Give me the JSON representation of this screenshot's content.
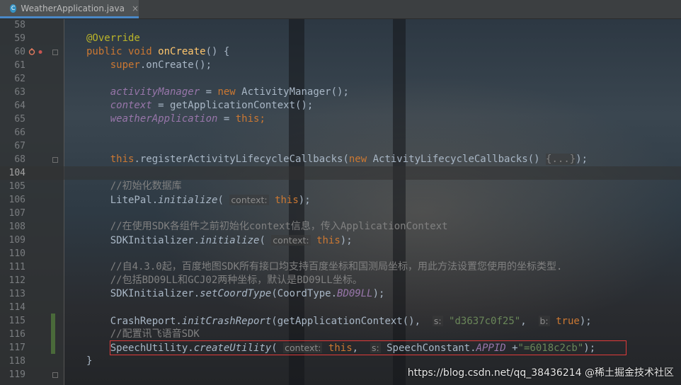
{
  "tab": {
    "filename": "WeatherApplication.java",
    "icon": "C",
    "close": "×"
  },
  "lines": [
    {
      "n": "58",
      "segs": []
    },
    {
      "n": "59",
      "segs": [
        {
          "t": "@Override",
          "c": "ann"
        }
      ]
    },
    {
      "n": "60",
      "segs": [
        {
          "t": "public void ",
          "c": "kw"
        },
        {
          "t": "onCreate",
          "c": "fn"
        },
        {
          "t": "() {",
          "c": ""
        }
      ]
    },
    {
      "n": "61",
      "segs": [
        {
          "t": "    super",
          "c": "kw"
        },
        {
          "t": ".onCreate();",
          "c": ""
        }
      ]
    },
    {
      "n": "62",
      "segs": []
    },
    {
      "n": "63",
      "segs": [
        {
          "t": "    ",
          "c": ""
        },
        {
          "t": "activityManager",
          "c": "field"
        },
        {
          "t": " = ",
          "c": ""
        },
        {
          "t": "new ",
          "c": "kw"
        },
        {
          "t": "ActivityManager();",
          "c": ""
        }
      ]
    },
    {
      "n": "64",
      "segs": [
        {
          "t": "    ",
          "c": ""
        },
        {
          "t": "context",
          "c": "field"
        },
        {
          "t": " = getApplicationContext();",
          "c": ""
        }
      ]
    },
    {
      "n": "65",
      "segs": [
        {
          "t": "    ",
          "c": ""
        },
        {
          "t": "weatherApplication",
          "c": "field"
        },
        {
          "t": " = ",
          "c": ""
        },
        {
          "t": "this",
          "c": "kw"
        },
        {
          "t": ";",
          "c": "kw"
        }
      ]
    },
    {
      "n": "66",
      "segs": []
    },
    {
      "n": "67",
      "segs": []
    },
    {
      "n": "68",
      "segs": [
        {
          "t": "    this",
          "c": "kw"
        },
        {
          "t": ".registerActivityLifecycleCallbacks(",
          "c": ""
        },
        {
          "t": "new ",
          "c": "kw"
        },
        {
          "t": "ActivityLifecycleCallbacks() ",
          "c": ""
        },
        {
          "t": "{...}",
          "c": "fold"
        },
        {
          "t": ");",
          "c": ""
        }
      ]
    },
    {
      "n": "104",
      "segs": [],
      "current": true
    },
    {
      "n": "105",
      "segs": [
        {
          "t": "    //初始化数据库",
          "c": "cmt"
        }
      ]
    },
    {
      "n": "106",
      "segs": [
        {
          "t": "    LitePal.",
          "c": ""
        },
        {
          "t": "initialize",
          "c": "ital"
        },
        {
          "t": "( ",
          "c": ""
        },
        {
          "t": "context:",
          "c": "hint"
        },
        {
          "t": " ",
          "c": ""
        },
        {
          "t": "this",
          "c": "kw"
        },
        {
          "t": ");",
          "c": ""
        }
      ]
    },
    {
      "n": "107",
      "segs": []
    },
    {
      "n": "108",
      "segs": [
        {
          "t": "    //在使用SDK各组件之前初始化context信息，传入ApplicationContext",
          "c": "cmt"
        }
      ]
    },
    {
      "n": "109",
      "segs": [
        {
          "t": "    SDKInitializer.",
          "c": ""
        },
        {
          "t": "initialize",
          "c": "ital"
        },
        {
          "t": "( ",
          "c": ""
        },
        {
          "t": "context:",
          "c": "hint"
        },
        {
          "t": " ",
          "c": ""
        },
        {
          "t": "this",
          "c": "kw"
        },
        {
          "t": ");",
          "c": ""
        }
      ]
    },
    {
      "n": "110",
      "segs": []
    },
    {
      "n": "111",
      "segs": [
        {
          "t": "    //自4.3.0起，百度地图SDK所有接口均支持百度坐标和国测局坐标，用此方法设置您使用的坐标类型.",
          "c": "cmt"
        }
      ]
    },
    {
      "n": "112",
      "segs": [
        {
          "t": "    //包括BD09LL和GCJ02两种坐标，默认是BD09LL坐标。",
          "c": "cmt"
        }
      ]
    },
    {
      "n": "113",
      "segs": [
        {
          "t": "    SDKInitializer.",
          "c": ""
        },
        {
          "t": "setCoordType",
          "c": "ital"
        },
        {
          "t": "(CoordType.",
          "c": ""
        },
        {
          "t": "BD09LL",
          "c": "field"
        },
        {
          "t": ");",
          "c": ""
        }
      ]
    },
    {
      "n": "114",
      "segs": []
    },
    {
      "n": "115",
      "segs": [
        {
          "t": "    CrashReport.",
          "c": ""
        },
        {
          "t": "initCrashReport",
          "c": "ital"
        },
        {
          "t": "(getApplicationContext(),  ",
          "c": ""
        },
        {
          "t": "s:",
          "c": "hint"
        },
        {
          "t": " ",
          "c": ""
        },
        {
          "t": "\"d3637c0f25\"",
          "c": "str"
        },
        {
          "t": ",  ",
          "c": ""
        },
        {
          "t": "b:",
          "c": "hint"
        },
        {
          "t": " ",
          "c": ""
        },
        {
          "t": "true",
          "c": "kw"
        },
        {
          "t": ");",
          "c": ""
        }
      ]
    },
    {
      "n": "116",
      "segs": [
        {
          "t": "    //配置讯飞语音SDK",
          "c": "cmt"
        }
      ]
    },
    {
      "n": "117",
      "segs": [
        {
          "t": "    SpeechUtility.",
          "c": ""
        },
        {
          "t": "createUtility",
          "c": "ital"
        },
        {
          "t": "( ",
          "c": ""
        },
        {
          "t": "context:",
          "c": "hint"
        },
        {
          "t": " ",
          "c": ""
        },
        {
          "t": "this",
          "c": "kw"
        },
        {
          "t": ",  ",
          "c": ""
        },
        {
          "t": "s:",
          "c": "hint"
        },
        {
          "t": " SpeechConstant.",
          "c": ""
        },
        {
          "t": "APPID",
          "c": "field"
        },
        {
          "t": " +",
          "c": ""
        },
        {
          "t": "\"=6018c2cb\"",
          "c": "str"
        },
        {
          "t": ");",
          "c": ""
        }
      ]
    },
    {
      "n": "118",
      "segs": [
        {
          "t": "}",
          "c": ""
        }
      ]
    },
    {
      "n": "119",
      "segs": []
    }
  ],
  "watermark": "https://blog.csdn.net/qq_38436214",
  "watermark2": "@稀土掘金技术社区",
  "colors": {
    "keyword": "#cc7832",
    "annotation": "#bbb529",
    "method": "#ffc66d",
    "field": "#9876aa",
    "string": "#6a8759",
    "comment": "#808080",
    "highlight_box": "#e03a3a"
  }
}
